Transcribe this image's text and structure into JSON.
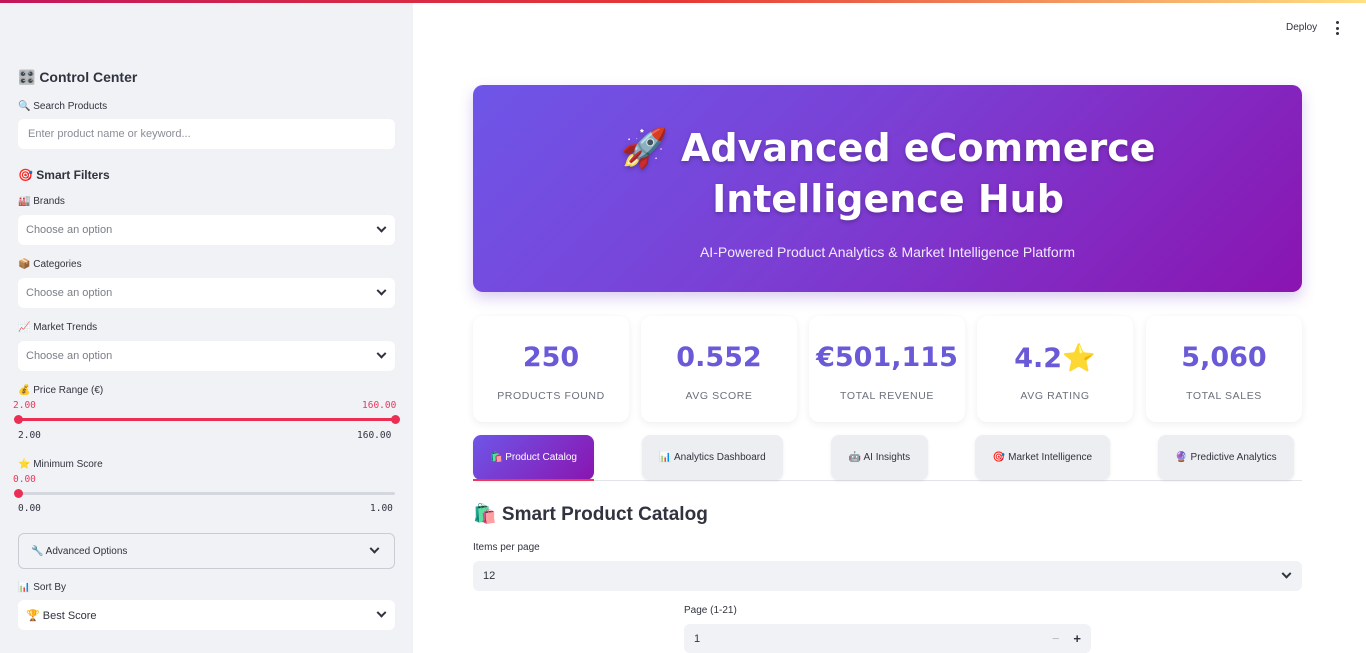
{
  "sidebar": {
    "title": "🎛️ Control Center",
    "search": {
      "label": "🔍 Search Products",
      "placeholder": "Enter product name or keyword..."
    },
    "filters_title": "🎯 Smart Filters",
    "brands": {
      "label": "🏭 Brands",
      "value": "Choose an option"
    },
    "categories": {
      "label": "📦 Categories",
      "value": "Choose an option"
    },
    "trends": {
      "label": "📈 Market Trends",
      "value": "Choose an option"
    },
    "price": {
      "label": "💰 Price Range (€)",
      "low": "2.00",
      "high": "160.00",
      "min": "2.00",
      "max": "160.00",
      "low_fraction": 0,
      "high_fraction": 1
    },
    "score": {
      "label": "⭐ Minimum Score",
      "value": "0.00",
      "min": "0.00",
      "max": "1.00",
      "fraction": 0
    },
    "advanced": "🔧 Advanced Options",
    "sort": {
      "label": "📊 Sort By",
      "value": "🏆 Best Score"
    }
  },
  "header": {
    "deploy": "Deploy"
  },
  "hero": {
    "title": "🚀 Advanced eCommerce Intelligence Hub",
    "subtitle": "AI-Powered Product Analytics & Market Intelligence Platform"
  },
  "metrics": [
    {
      "value": "250",
      "label": "Products Found"
    },
    {
      "value": "0.552",
      "label": "Avg Score"
    },
    {
      "value": "€501,115",
      "label": "Total Revenue"
    },
    {
      "value": "4.2⭐",
      "label": "Avg Rating"
    },
    {
      "value": "5,060",
      "label": "Total Sales"
    }
  ],
  "tabs": [
    {
      "label": "🛍️ Product Catalog"
    },
    {
      "label": "📊 Analytics Dashboard"
    },
    {
      "label": "🤖 AI Insights"
    },
    {
      "label": "🎯 Market Intelligence"
    },
    {
      "label": "🔮 Predictive Analytics"
    }
  ],
  "catalog": {
    "title": "🛍️ Smart Product Catalog",
    "items_label": "Items per page",
    "items_value": "12",
    "page_label": "Page (1-21)",
    "page_value": "1"
  },
  "colors": {
    "accent": "#ec2e55",
    "hero_start": "#6e56e8",
    "hero_end": "#8a14b0",
    "metric": "#6a5ad8"
  }
}
